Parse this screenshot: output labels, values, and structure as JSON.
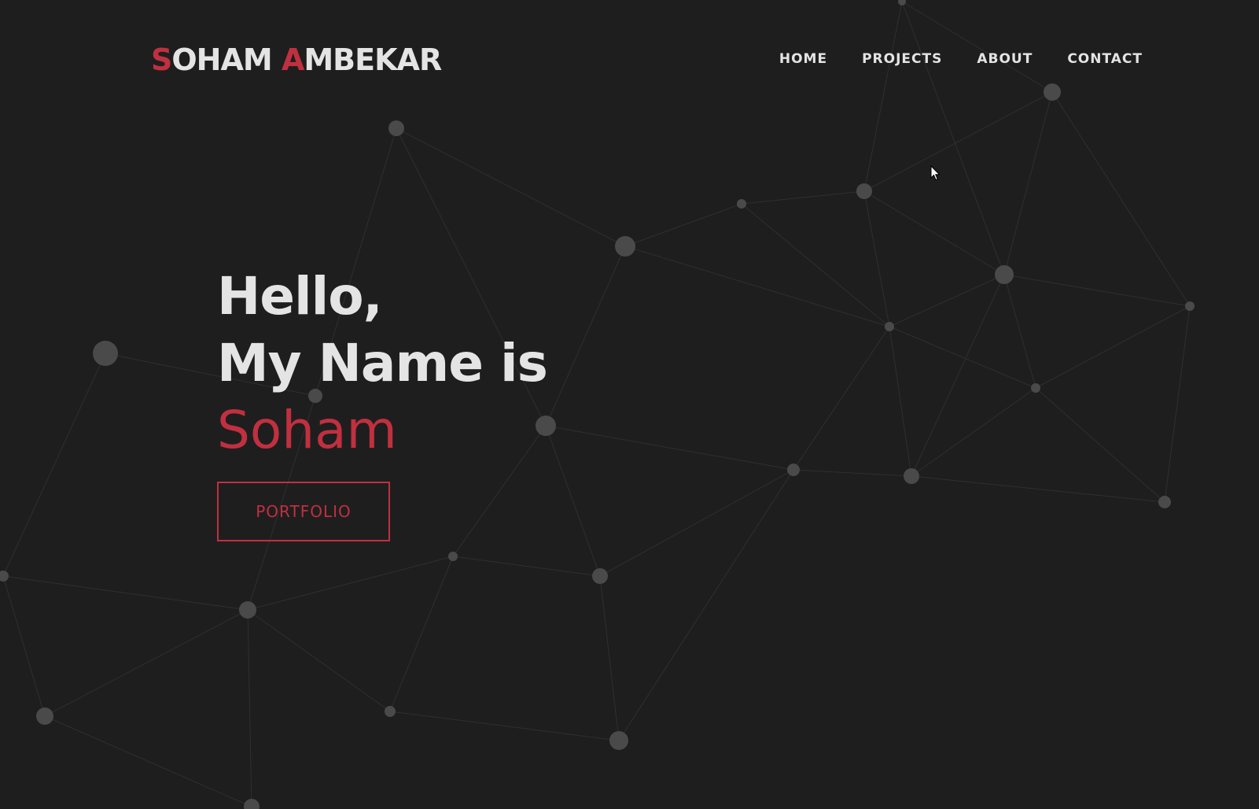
{
  "header": {
    "logo": {
      "first_initial": "S",
      "first_rest": "OHAM ",
      "last_initial": "A",
      "last_rest": "MBEKAR"
    },
    "nav": [
      {
        "label": "HOME"
      },
      {
        "label": "PROJECTS"
      },
      {
        "label": "ABOUT"
      },
      {
        "label": "CONTACT"
      }
    ]
  },
  "hero": {
    "line1": "Hello,",
    "line2": "My Name is",
    "name": "Soham",
    "button_label": "PORTFOLIO"
  },
  "colors": {
    "background": "#1e1e1f",
    "text": "#e4e4e4",
    "accent": "#c0303f",
    "node": "#4a4a4a",
    "link": "#2f2f30"
  }
}
